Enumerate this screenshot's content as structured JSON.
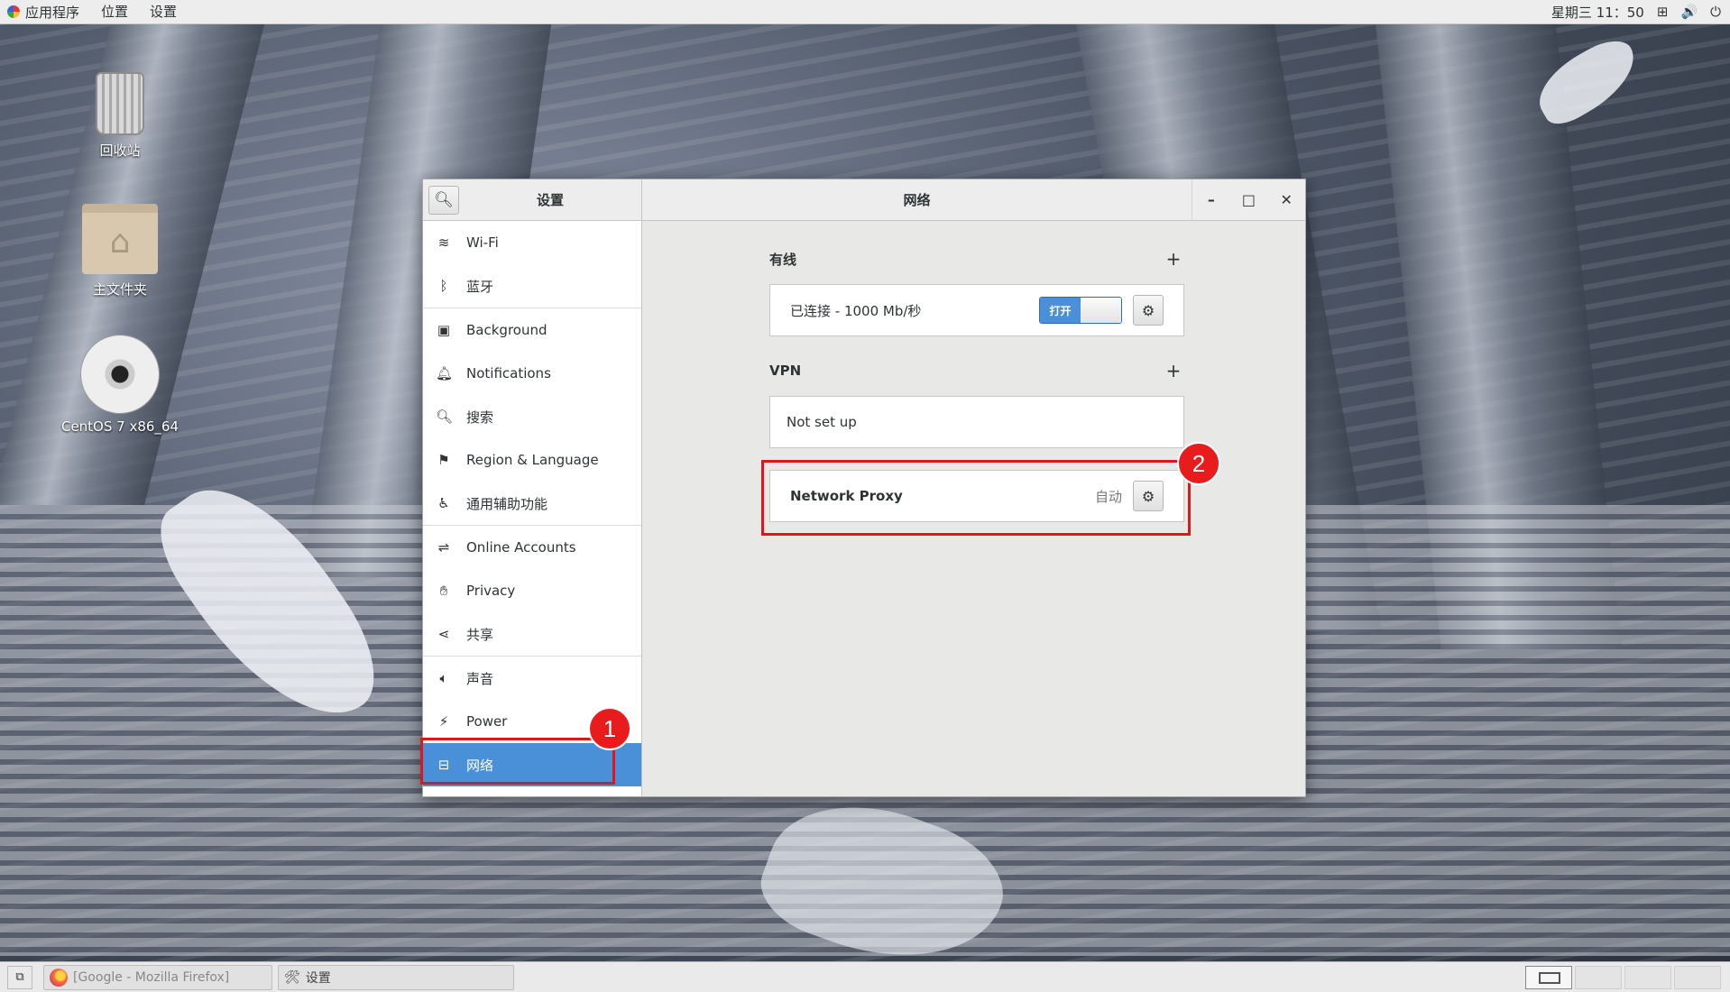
{
  "topbar": {
    "menus": [
      "应用程序",
      "位置",
      "设置"
    ],
    "clock": "星期三 11：50",
    "network_icon": "network-icon",
    "volume_icon": "volume-icon",
    "power_icon": "power-icon"
  },
  "desktop": {
    "icons": [
      {
        "label": "回收站",
        "icon": "trash-icon"
      },
      {
        "label": "主文件夹",
        "icon": "home-folder-icon"
      },
      {
        "label": "CentOS 7 x86_64",
        "icon": "disc-icon"
      }
    ]
  },
  "window": {
    "sidebar_title": "设置",
    "content_title": "网络",
    "sidebar_items": [
      {
        "label": "Wi-Fi",
        "icon": "wifi-icon"
      },
      {
        "label": "蓝牙",
        "icon": "bluetooth-icon"
      },
      {
        "label": "Background",
        "icon": "background-icon"
      },
      {
        "label": "Notifications",
        "icon": "bell-icon"
      },
      {
        "label": "搜索",
        "icon": "search-icon"
      },
      {
        "label": "Region & Language",
        "icon": "region-icon"
      },
      {
        "label": "通用辅助功能",
        "icon": "accessibility-icon"
      },
      {
        "label": "Online Accounts",
        "icon": "online-accounts-icon"
      },
      {
        "label": "Privacy",
        "icon": "privacy-hand-icon"
      },
      {
        "label": "共享",
        "icon": "share-icon"
      },
      {
        "label": "声音",
        "icon": "sound-icon"
      },
      {
        "label": "Power",
        "icon": "power-icon"
      },
      {
        "label": "网络",
        "icon": "network-icon",
        "active": true
      }
    ],
    "wired": {
      "heading": "有线",
      "add": "+",
      "status": "已连接 - 1000 Mb/秒",
      "switch_label": "打开"
    },
    "vpn": {
      "heading": "VPN",
      "add": "+",
      "status": "Not set up"
    },
    "proxy": {
      "label": "Network Proxy",
      "value": "自动"
    }
  },
  "annotations": {
    "badge1": "1",
    "badge2": "2",
    "color": "#e0161a"
  },
  "taskbar": {
    "tasks": [
      "[Google - Mozilla Firefox]",
      "设置"
    ]
  }
}
